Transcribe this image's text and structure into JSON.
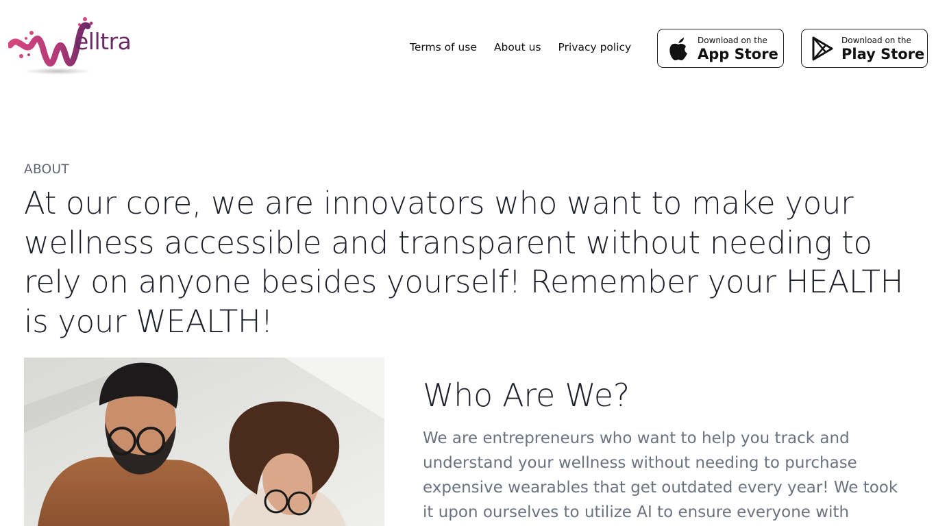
{
  "brand": {
    "name": "Welltra",
    "logo_text": "elltra",
    "accent": "#6b2a66",
    "accent_pink": "#d7477f"
  },
  "nav": {
    "items": [
      {
        "label": "Terms of use"
      },
      {
        "label": "About us"
      },
      {
        "label": "Privacy policy"
      }
    ]
  },
  "stores": {
    "apple": {
      "small": "Download on the",
      "big": "App Store",
      "icon": "apple-icon"
    },
    "play": {
      "small": "Download on the",
      "big": "Play Store",
      "icon": "play-store-icon"
    }
  },
  "hero": {
    "eyebrow": "ABOUT",
    "headline": "At our core, we are innovators who want to make your wellness accessible and transparent without needing to rely on anyone besides yourself! Remember your HEALTH is your WEALTH!"
  },
  "who": {
    "title": "Who Are We?",
    "body": "We are entrepreneurs who want to help you track and understand your wellness without needing to purchase expensive wearables that get outdated every year! We took it upon ourselves to utilize AI to ensure everyone with"
  },
  "photo": {
    "subject": "two-people-photo"
  }
}
